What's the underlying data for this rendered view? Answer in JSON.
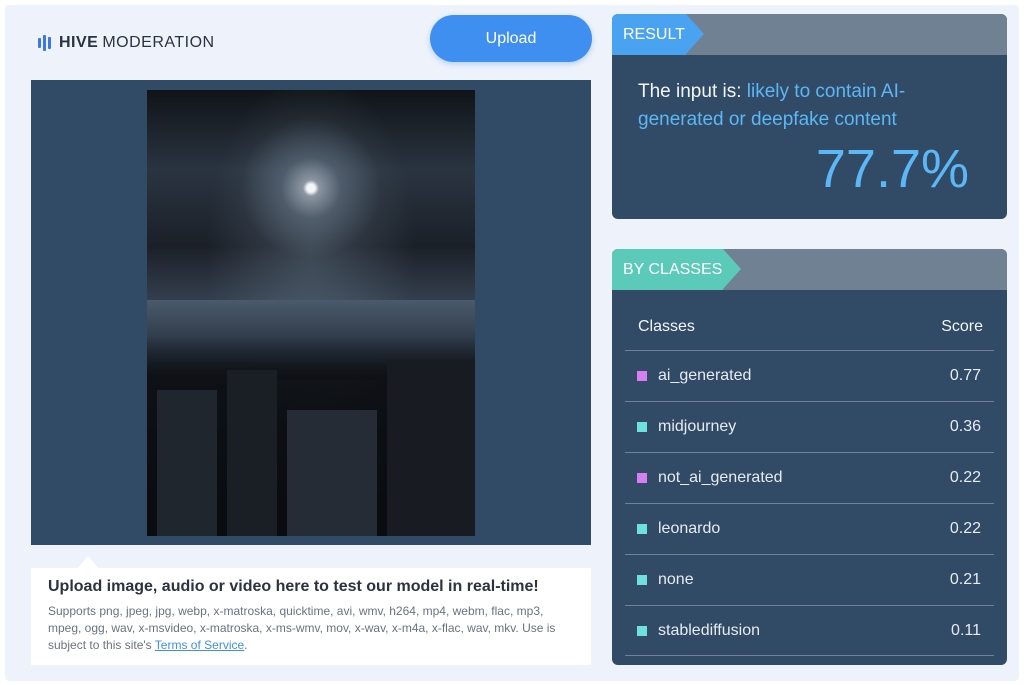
{
  "header": {
    "logo_bold": "HIVE",
    "logo_light": "MODERATION",
    "upload_label": "Upload"
  },
  "info": {
    "title": "Upload image, audio or video here to test our model in real-time!",
    "supports_text": "Supports png, jpeg, jpg, webp, x-matroska, quicktime, avi, wmv, h264, mp4, webm, flac, mp3, mpeg, ogg, wav, x-msvideo, x-matroska, x-ms-wmv, mov, x-wav, x-m4a, x-flac, wav, mkv. Use is subject to this site's ",
    "terms_link": "Terms of Service",
    "terms_suffix": "."
  },
  "result": {
    "tag": "RESULT",
    "prefix": "The input is: ",
    "verdict": "likely to contain AI-generated or deepfake content",
    "score": "77.7%"
  },
  "classes": {
    "tag": "BY CLASSES",
    "col_class": "Classes",
    "col_score": "Score",
    "rows": [
      {
        "name": "ai_generated",
        "score": "0.77",
        "color": "#d77ef0"
      },
      {
        "name": "midjourney",
        "score": "0.36",
        "color": "#6fe0e0"
      },
      {
        "name": "not_ai_generated",
        "score": "0.22",
        "color": "#d77ef0"
      },
      {
        "name": "leonardo",
        "score": "0.22",
        "color": "#6fe0e0"
      },
      {
        "name": "none",
        "score": "0.21",
        "color": "#6fe0e0"
      },
      {
        "name": "stablediffusion",
        "score": "0.11",
        "color": "#6fe0e0"
      }
    ]
  },
  "colors": {
    "accent_blue": "#3f8ff0",
    "panel_bg": "#314a65",
    "result_tag": "#4aa3f0",
    "classes_tag": "#5ccab8",
    "highlight": "#5bb7f5"
  }
}
